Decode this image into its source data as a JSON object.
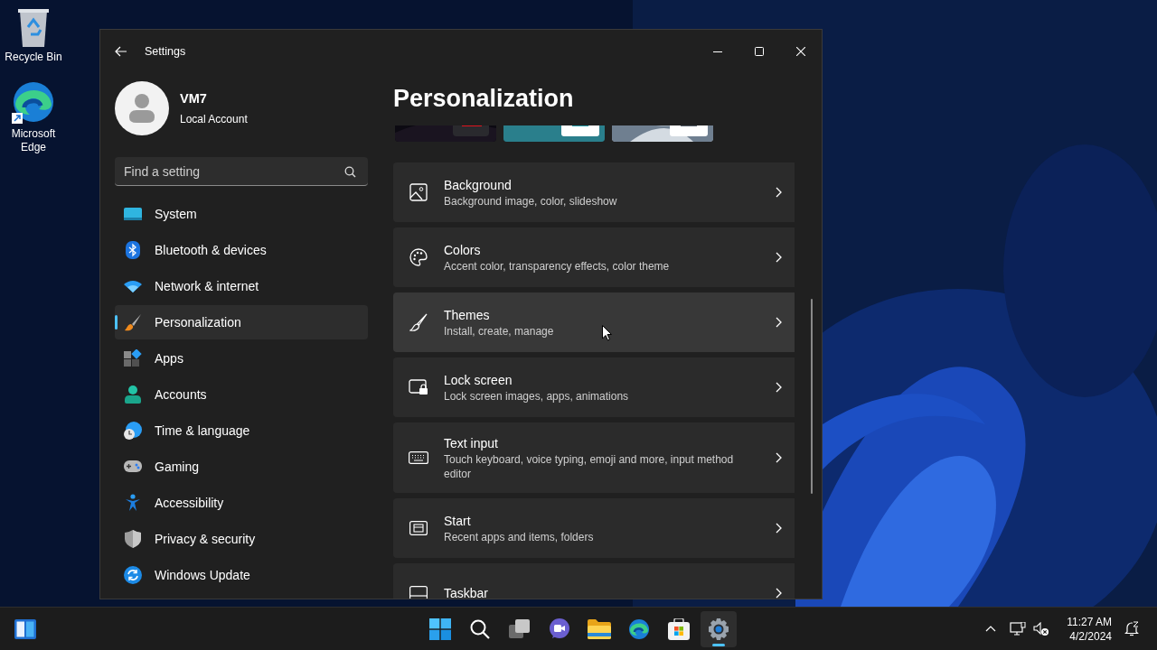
{
  "desktop_icons": [
    {
      "label": "Recycle Bin",
      "kind": "recycle"
    },
    {
      "label": "Microsoft Edge",
      "kind": "edge"
    }
  ],
  "window": {
    "title": "Settings"
  },
  "user": {
    "name": "VM7",
    "account": "Local Account"
  },
  "search": {
    "placeholder": "Find a setting"
  },
  "nav": [
    {
      "label": "System",
      "kind": "system",
      "selected": false
    },
    {
      "label": "Bluetooth & devices",
      "kind": "bluetooth",
      "selected": false
    },
    {
      "label": "Network & internet",
      "kind": "network",
      "selected": false
    },
    {
      "label": "Personalization",
      "kind": "personalization",
      "selected": true
    },
    {
      "label": "Apps",
      "kind": "apps",
      "selected": false
    },
    {
      "label": "Accounts",
      "kind": "accounts",
      "selected": false
    },
    {
      "label": "Time & language",
      "kind": "time",
      "selected": false
    },
    {
      "label": "Gaming",
      "kind": "gaming",
      "selected": false
    },
    {
      "label": "Accessibility",
      "kind": "accessibility",
      "selected": false
    },
    {
      "label": "Privacy & security",
      "kind": "privacy",
      "selected": false
    },
    {
      "label": "Windows Update",
      "kind": "update",
      "selected": false
    }
  ],
  "page_title": "Personalization",
  "cards": [
    {
      "title": "Background",
      "subtitle": "Background image, color, slideshow",
      "kind": "background",
      "hovered": false
    },
    {
      "title": "Colors",
      "subtitle": "Accent color, transparency effects, color theme",
      "kind": "colors",
      "hovered": false
    },
    {
      "title": "Themes",
      "subtitle": "Install, create, manage",
      "kind": "themes",
      "hovered": true
    },
    {
      "title": "Lock screen",
      "subtitle": "Lock screen images, apps, animations",
      "kind": "lock",
      "hovered": false
    },
    {
      "title": "Text input",
      "subtitle": "Touch keyboard, voice typing, emoji and more, input method editor",
      "kind": "keyboard",
      "hovered": false
    },
    {
      "title": "Start",
      "subtitle": "Recent apps and items, folders",
      "kind": "start",
      "hovered": false
    },
    {
      "title": "Taskbar",
      "kind": "taskbar",
      "hovered": false
    }
  ],
  "taskbar": {
    "apps": [
      {
        "kind": "start",
        "active": false
      },
      {
        "kind": "search",
        "active": false
      },
      {
        "kind": "taskview",
        "active": false
      },
      {
        "kind": "chat",
        "active": false
      },
      {
        "kind": "explorer",
        "active": false
      },
      {
        "kind": "edge",
        "active": false
      },
      {
        "kind": "store",
        "active": false
      },
      {
        "kind": "settings",
        "active": true
      }
    ],
    "time": "11:27 AM",
    "date": "4/2/2024"
  }
}
